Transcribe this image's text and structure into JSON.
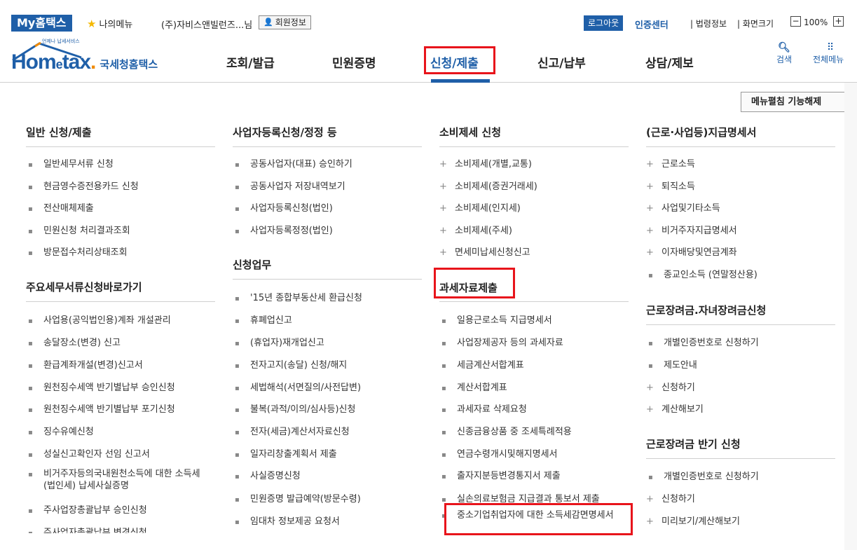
{
  "topbar": {
    "my_hometax": "My홈택스",
    "my_menu": "나의메뉴",
    "user_name": "(주)자비스앤빌런즈...님",
    "member_info": "회원정보",
    "logout": "로그아웃",
    "auth_center": "인증센터",
    "law_info": "법령정보",
    "screen_size": "화면크기",
    "zoom_minus": "−",
    "zoom_value": "100%",
    "zoom_plus": "+"
  },
  "header": {
    "logo_text_h": "Hom",
    "logo_text_e": "e",
    "logo_text_tax": "tax",
    "logo_dot": ".",
    "logo_small": "언제나 납세서비스",
    "logo_sub": "국세청홈택스",
    "gnb": [
      "조회/발급",
      "민원증명",
      "신청/제출",
      "신고/납부",
      "상담/제보"
    ],
    "search": "검색",
    "allmenu": "전체메뉴"
  },
  "menu_toggle": "메뉴펼침 기능해제",
  "columns": [
    {
      "sections": [
        {
          "title": "일반 신청/제출",
          "items": [
            "일반세무서류 신청",
            "현금영수증전용카드 신청",
            "전산매체제출",
            "민원신청 처리결과조회",
            "방문접수처리상태조회"
          ]
        },
        {
          "title": "주요세무서류신청바로가기",
          "items": [
            "사업용(공익법인용)계좌 개설관리",
            "송달장소(변경) 신고",
            "환급계좌개설(변경)신고서",
            "원천징수세액 반기별납부 승인신청",
            "원천징수세액 반기별납부 포기신청",
            "징수유예신청",
            "성실신고확인자 선임 신고서",
            "비거주자등의국내원천소득에 대한 소득세(법인세) 납세사실증명",
            "주사업장총괄납부 승인신청",
            "주사업자총괄납부 변경신청"
          ]
        }
      ]
    },
    {
      "sections": [
        {
          "title": "사업자등록신청/정정 등",
          "items": [
            "공동사업자(대표) 승인하기",
            "공동사업자 저장내역보기",
            "사업자등록신청(법인)",
            "사업자등록정정(법인)"
          ]
        },
        {
          "title": "신청업무",
          "items": [
            "'15년 종합부동산세 환급신청",
            "휴폐업신고",
            "(휴업자)재개업신고",
            "전자고지(송달) 신청/해지",
            "세법해석(서면질의/사전답변)",
            "불복(과적/이의/심사등)신청",
            "전자(세금)계산서자료신청",
            "일자리창출계획서 제출",
            "사실증명신청",
            "민원증명 발급예약(방문수령)",
            "임대차 정보제공 요청서"
          ]
        }
      ]
    },
    {
      "sections": [
        {
          "title": "소비제세 신청",
          "items": [
            "소비제세(개별,교통)",
            "소비제세(증권거래세)",
            "소비제세(인지세)",
            "소비제세(주세)",
            "면세미납세신청신고"
          ]
        },
        {
          "title": "과세자료제출",
          "items": [
            "일용근로소득 지급명세서",
            "사업장제공자 등의 과세자료",
            "세금계산서합계표",
            "계산서합계표",
            "과세자료 삭제요청",
            "신종금융상품 중 조세특례적용",
            "연금수령개시및해지명세서",
            "출자지분등변경통지서 제출",
            "실손의료보험금 지급결과 통보서 제출",
            "중소기업취업자에 대한 소득세감면명세서"
          ]
        }
      ]
    },
    {
      "sections": [
        {
          "title": "(근로·사업등)지급명세서",
          "items": [
            "근로소득",
            "퇴직소득",
            "사업및기타소득",
            "비거주자지급명세서",
            "이자배당및연금계좌",
            "종교인소득 (연말정산용)"
          ]
        },
        {
          "title": "근로장려금.자녀장려금신청",
          "items": [
            "개별인증번호로 신청하기",
            "제도안내",
            "신청하기",
            "계산해보기"
          ]
        },
        {
          "title": "근로장려금 반기 신청",
          "items": [
            "개별인증번호로 신청하기",
            "신청하기",
            "미리보기/계산해보기"
          ]
        }
      ]
    }
  ]
}
